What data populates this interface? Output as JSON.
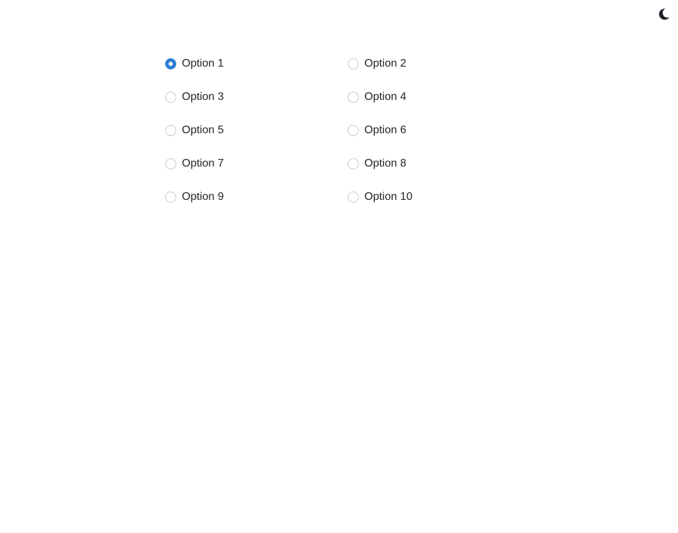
{
  "theme_toggle": {
    "icon": "moon-icon",
    "color": "#1e2229"
  },
  "accent_color": "#2f80d2",
  "radio_group": {
    "selected_index": 0,
    "options": [
      {
        "label": "Option 1",
        "checked": true
      },
      {
        "label": "Option 2",
        "checked": false
      },
      {
        "label": "Option 3",
        "checked": false
      },
      {
        "label": "Option 4",
        "checked": false
      },
      {
        "label": "Option 5",
        "checked": false
      },
      {
        "label": "Option 6",
        "checked": false
      },
      {
        "label": "Option 7",
        "checked": false
      },
      {
        "label": "Option 8",
        "checked": false
      },
      {
        "label": "Option 9",
        "checked": false
      },
      {
        "label": "Option 10",
        "checked": false
      }
    ]
  }
}
